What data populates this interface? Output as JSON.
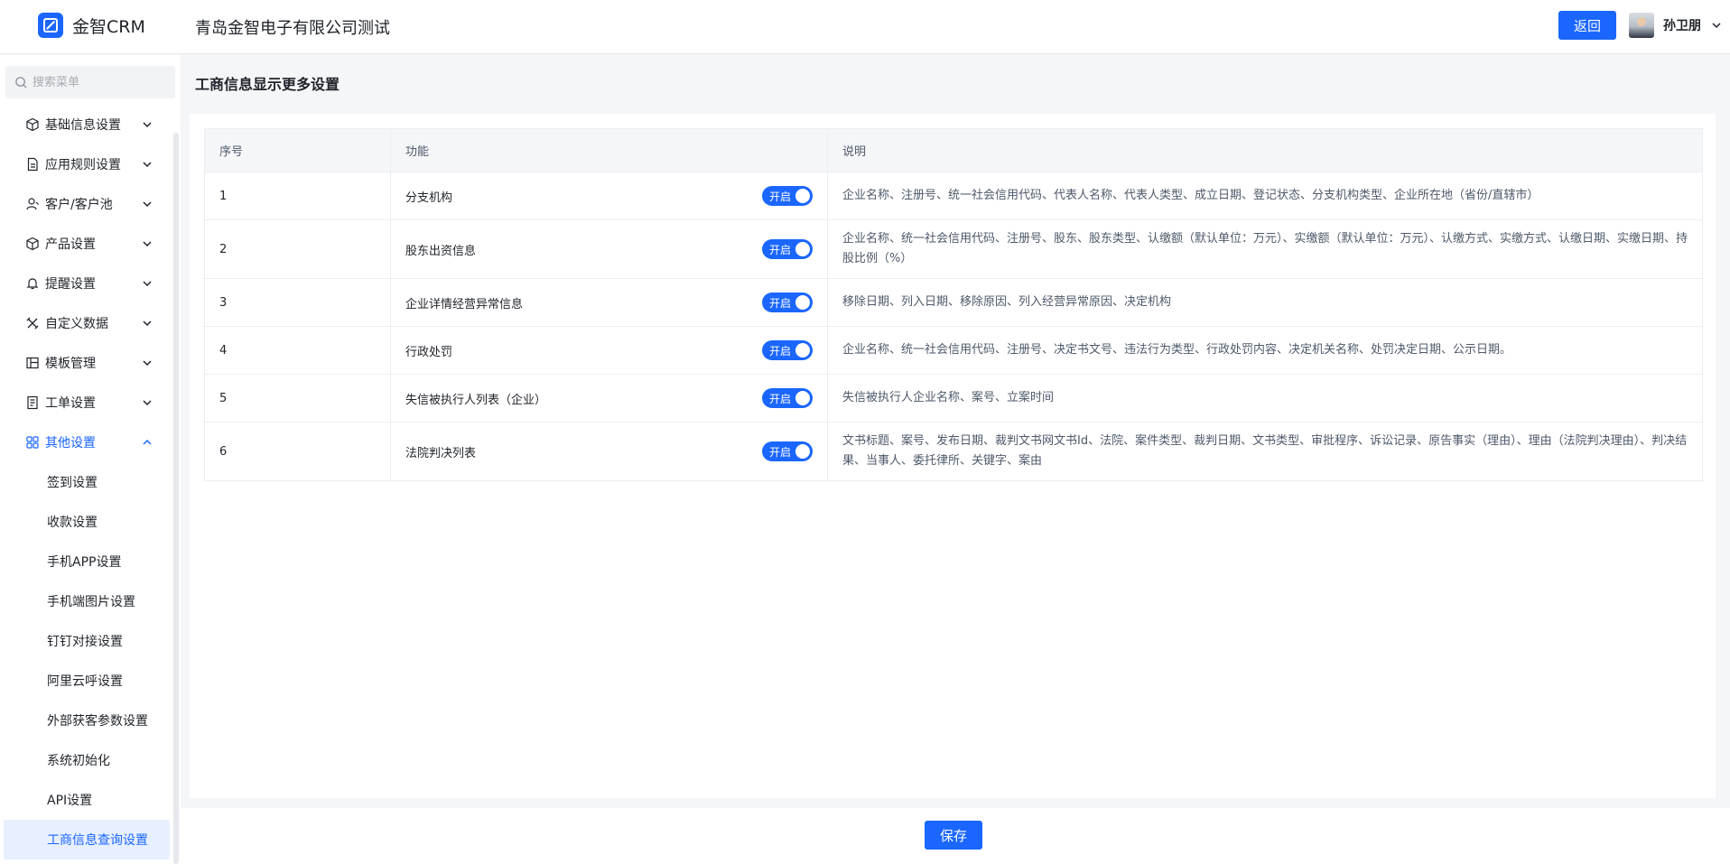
{
  "header": {
    "app_name": "金智CRM",
    "company": "青岛金智电子有限公司测试",
    "back_label": "返回",
    "user_name": "孙卫朋"
  },
  "sidebar": {
    "search_placeholder": "搜索菜单",
    "menu": [
      {
        "label": "基础信息设置",
        "icon": "cube-icon",
        "expanded": false
      },
      {
        "label": "应用规则设置",
        "icon": "document-icon",
        "expanded": false
      },
      {
        "label": "客户/客户池",
        "icon": "user-icon",
        "expanded": false
      },
      {
        "label": "产品设置",
        "icon": "box-icon",
        "expanded": false
      },
      {
        "label": "提醒设置",
        "icon": "bell-icon",
        "expanded": false
      },
      {
        "label": "自定义数据",
        "icon": "tools-icon",
        "expanded": false
      },
      {
        "label": "模板管理",
        "icon": "template-icon",
        "expanded": false
      },
      {
        "label": "工单设置",
        "icon": "ticket-icon",
        "expanded": false
      },
      {
        "label": "其他设置",
        "icon": "grid-icon",
        "expanded": true
      }
    ],
    "submenu": [
      "签到设置",
      "收款设置",
      "手机APP设置",
      "手机端图片设置",
      "钉钉对接设置",
      "阿里云呼设置",
      "外部获客参数设置",
      "系统初始化",
      "API设置",
      "工商信息查询设置"
    ],
    "selected_submenu": "工商信息查询设置"
  },
  "main": {
    "title": "工商信息显示更多设置",
    "columns": [
      "序号",
      "功能",
      "说明"
    ],
    "rows": [
      {
        "no": "1",
        "feature": "分支机构",
        "toggle": "开启",
        "desc": "企业名称、注册号、统一社会信用代码、代表人名称、代表人类型、成立日期、登记状态、分支机构类型、企业所在地（省份/直辖市）"
      },
      {
        "no": "2",
        "feature": "股东出资信息",
        "toggle": "开启",
        "desc": "企业名称、统一社会信用代码、注册号、股东、股东类型、认缴额（默认单位：万元）、实缴额（默认单位：万元）、认缴方式、实缴方式、认缴日期、实缴日期、持股比例（%）"
      },
      {
        "no": "3",
        "feature": "企业详情经营异常信息",
        "toggle": "开启",
        "desc": "移除日期、列入日期、移除原因、列入经营异常原因、决定机构"
      },
      {
        "no": "4",
        "feature": "行政处罚",
        "toggle": "开启",
        "desc": "企业名称、统一社会信用代码、注册号、决定书文号、违法行为类型、行政处罚内容、决定机关名称、处罚决定日期、公示日期。"
      },
      {
        "no": "5",
        "feature": "失信被执行人列表（企业）",
        "toggle": "开启",
        "desc": "失信被执行人企业名称、案号、立案时间"
      },
      {
        "no": "6",
        "feature": "法院判决列表",
        "toggle": "开启",
        "desc": "文书标题、案号、发布日期、裁判文书网文书Id、法院、案件类型、裁判日期、文书类型、审批程序、诉讼记录、原告事实（理由）、理由（法院判决理由）、判决结果、当事人、委托律所、关键字、案由"
      }
    ]
  },
  "footer": {
    "save_label": "保存"
  },
  "colors": {
    "accent": "#1a66ff",
    "selected_bg": "#e8f0ff"
  }
}
